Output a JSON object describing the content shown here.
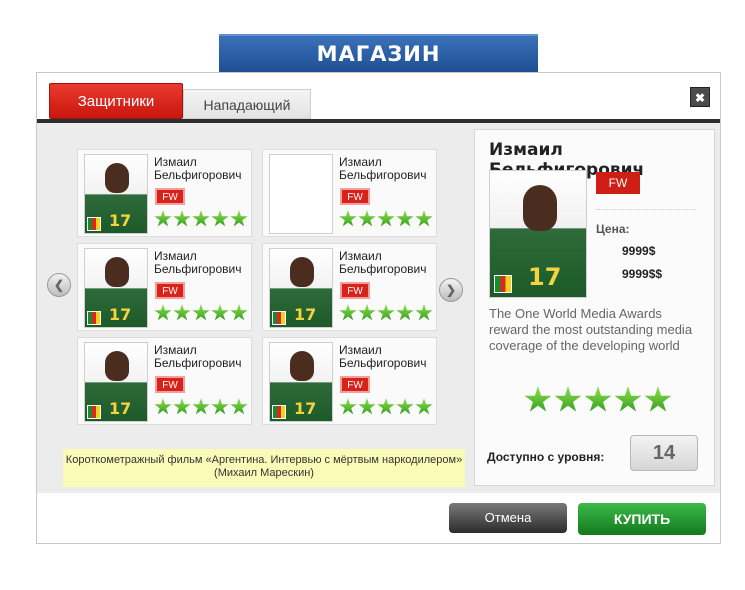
{
  "header": {
    "title": "МАГАЗИН"
  },
  "tabs": [
    {
      "label": "Защитники",
      "active": true
    },
    {
      "label": "Нападающий",
      "active": false
    }
  ],
  "close_label": "✖",
  "cards": [
    {
      "name": "Измаил Бельфигорович",
      "position": "FW",
      "stars": 5,
      "empty": false
    },
    {
      "name": "Измаил Бельфигорович",
      "position": "FW",
      "stars": 5,
      "empty": true
    },
    {
      "name": "Измаил Бельфигорович",
      "position": "FW",
      "stars": 5,
      "empty": false
    },
    {
      "name": "Измаил Бельфигорович",
      "position": "FW",
      "stars": 5,
      "empty": false
    },
    {
      "name": "Измаил Бельфигорович",
      "position": "FW",
      "stars": 5,
      "empty": false
    },
    {
      "name": "Измаил Бельфигорович",
      "position": "FW",
      "stars": 5,
      "empty": false
    }
  ],
  "note": "Короткометражный фильм «Аргентина. Интервью с мёртвым наркодилером» (Михаил Марескин)",
  "details": {
    "name": "Измаил Бельфигорович",
    "position": "FW",
    "price_label": "Цена:",
    "price1": "9999$",
    "price2": "9999$$",
    "description": "The One World Media Awards reward the most outstanding media coverage of the developing world",
    "stars": 5,
    "level_label": "Доступно с уровня:",
    "level": "14"
  },
  "buttons": {
    "cancel": "Отмена",
    "buy": "КУПИТЬ"
  },
  "colors": {
    "accent_red": "#d9221a",
    "buy_green": "#1f8f2a",
    "header_blue": "#2a5fa8"
  }
}
